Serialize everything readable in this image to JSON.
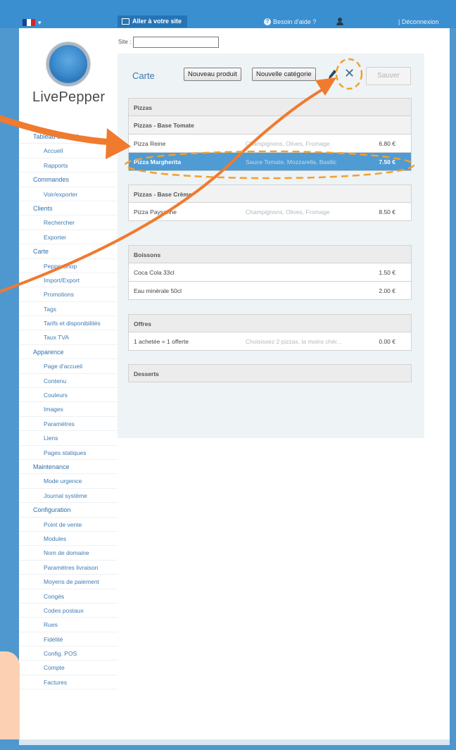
{
  "topbar": {
    "flag_colors": [
      "#1e3f8c",
      "#ffffff",
      "#d8232a"
    ],
    "visit_site_label": "Aller à votre site",
    "help_label": "Besoin d'aide ?",
    "logout_label": "| Déconnexion"
  },
  "site": {
    "label": "Site :",
    "value": ""
  },
  "logo": {
    "text": "LivePepper"
  },
  "sidebar": [
    {
      "type": "head",
      "label": "Tableau de bord"
    },
    {
      "type": "item",
      "label": "Accueil"
    },
    {
      "type": "item",
      "label": "Rapports"
    },
    {
      "type": "head",
      "label": "Commandes"
    },
    {
      "type": "item",
      "label": "Voir/exporter"
    },
    {
      "type": "head",
      "label": "Clients"
    },
    {
      "type": "item",
      "label": "Rechercher"
    },
    {
      "type": "item",
      "label": "Exporter"
    },
    {
      "type": "head",
      "label": "Carte"
    },
    {
      "type": "item",
      "label": "PepperShop"
    },
    {
      "type": "item",
      "label": "Import/Export"
    },
    {
      "type": "item",
      "label": "Promotions"
    },
    {
      "type": "item",
      "label": "Tags"
    },
    {
      "type": "item",
      "label": "Tarifs et disponibilités"
    },
    {
      "type": "item",
      "label": "Taux TVA"
    },
    {
      "type": "head",
      "label": "Apparence"
    },
    {
      "type": "item",
      "label": "Page d'accueil"
    },
    {
      "type": "item",
      "label": "Contenu"
    },
    {
      "type": "item",
      "label": "Couleurs"
    },
    {
      "type": "item",
      "label": "Images"
    },
    {
      "type": "item",
      "label": "Paramètres"
    },
    {
      "type": "item",
      "label": "Liens"
    },
    {
      "type": "item",
      "label": "Pages statiques"
    },
    {
      "type": "head",
      "label": "Maintenance"
    },
    {
      "type": "item",
      "label": "Mode urgence"
    },
    {
      "type": "item",
      "label": "Journal système"
    },
    {
      "type": "head",
      "label": "Configuration"
    },
    {
      "type": "item",
      "label": "Point de vente"
    },
    {
      "type": "item",
      "label": "Modules"
    },
    {
      "type": "item",
      "label": "Nom de domaine"
    },
    {
      "type": "item",
      "label": "Paramètres livraison"
    },
    {
      "type": "item",
      "label": "Moyens de paiement"
    },
    {
      "type": "item",
      "label": "Congés"
    },
    {
      "type": "item",
      "label": "Codes postaux"
    },
    {
      "type": "item",
      "label": "Rues"
    },
    {
      "type": "item",
      "label": "Fidélité"
    },
    {
      "type": "item",
      "label": "Config. POS"
    },
    {
      "type": "item",
      "label": "Compte"
    },
    {
      "type": "item",
      "label": "Factures"
    }
  ],
  "carte": {
    "title": "Carte",
    "new_product_label": "Nouveau produit",
    "new_category_label": "Nouvelle catégorie",
    "save_label": "Sauver"
  },
  "menu": {
    "pizzas": {
      "name": "Pizzas",
      "tomate": {
        "name": "Pizzas - Base Tomate",
        "items": [
          {
            "name": "Pizza Reine",
            "desc": "Champignons, Olives, Fromage",
            "price": "6.80 €"
          },
          {
            "name": "Pizza Margherita",
            "desc": "Sauce Tomate, Mozzarella, Basilic",
            "price": "7.50 €"
          }
        ]
      },
      "creme": {
        "name": "Pizzas - Base Crème",
        "items": [
          {
            "name": "Pizza Paysanne",
            "desc": "Champignons, Olives, Fromage",
            "price": "8.50 €"
          }
        ]
      }
    },
    "boissons": {
      "name": "Boissons",
      "items": [
        {
          "name": "Coca Cola 33cl",
          "desc": "",
          "price": "1.50 €"
        },
        {
          "name": "Eau minérale 50cl",
          "desc": "",
          "price": "2.00 €"
        }
      ]
    },
    "offres": {
      "name": "Offres",
      "items": [
        {
          "name": "1 achetée = 1 offerte",
          "desc": "Choisissez 2 pizzas, la moins chèr...",
          "price": "0.00 €"
        }
      ]
    },
    "desserts": {
      "name": "Desserts"
    }
  },
  "annotation": {
    "color": "#f07a2e",
    "highlight_color": "#f2a02e"
  }
}
